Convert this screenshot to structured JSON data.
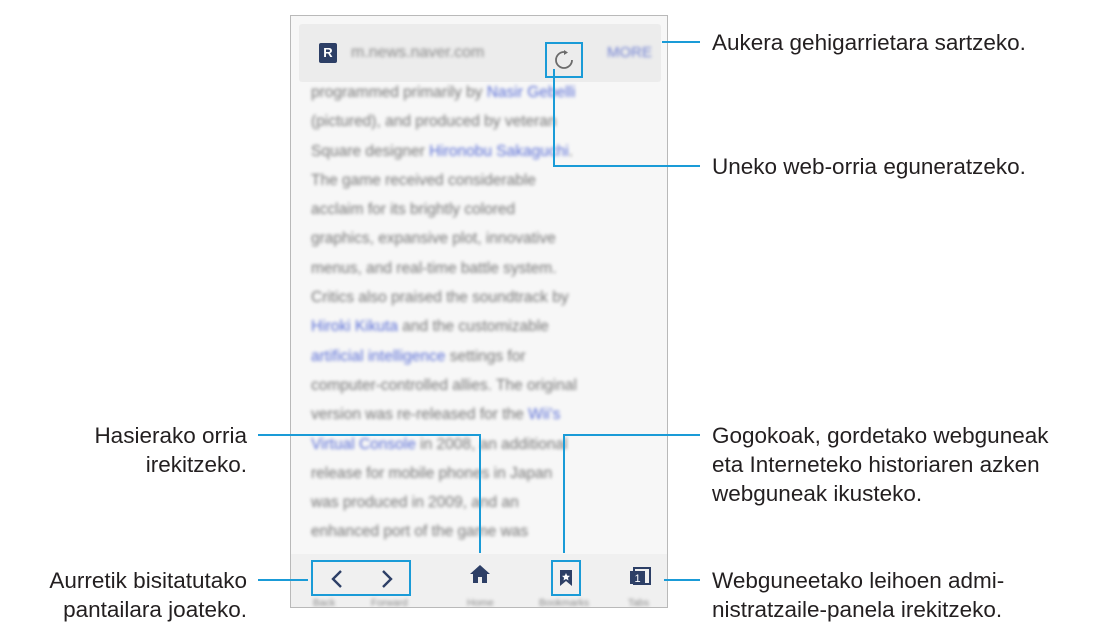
{
  "browser": {
    "url": "m.news.naver.com",
    "more_label": "MORE",
    "article_lines": [
      [
        {
          "t": "programmed primarily by "
        },
        {
          "t": "Nasir Gebelli",
          "link": true
        }
      ],
      [
        {
          "t": "(pictured), and produced by veteran"
        }
      ],
      [
        {
          "t": "Square designer "
        },
        {
          "t": "Hironobu Sakaguchi",
          "link": true
        },
        {
          "t": "."
        }
      ],
      [
        {
          "t": "The game received considerable"
        }
      ],
      [
        {
          "t": "acclaim for its brightly colored"
        }
      ],
      [
        {
          "t": "graphics, expansive plot, innovative"
        }
      ],
      [
        {
          "t": "menus, and real-time battle system."
        }
      ],
      [
        {
          "t": "Critics also praised the soundtrack by"
        }
      ],
      [
        {
          "t": "Hiroki Kikuta",
          "link": true
        },
        {
          "t": " and the customizable"
        }
      ],
      [
        {
          "t": "artificial intelligence",
          "link": true
        },
        {
          "t": " settings for"
        }
      ],
      [
        {
          "t": "computer-controlled allies. The original"
        }
      ],
      [
        {
          "t": "version was re-released for the "
        },
        {
          "t": "Wii's",
          "link": true
        }
      ],
      [
        {
          "t": "Virtual Console",
          "link": true
        },
        {
          "t": " in 2008, an additional"
        }
      ],
      [
        {
          "t": "release for mobile phones in Japan"
        }
      ],
      [
        {
          "t": "was produced in 2009, and an"
        }
      ],
      [
        {
          "t": "enhanced port of the game was"
        }
      ]
    ],
    "nav_labels": {
      "back": "Back",
      "forward": "Forward",
      "home": "Home",
      "bookmarks": "Bookmarks",
      "tabs": "Tabs"
    },
    "tabs_count": "1"
  },
  "callouts": {
    "more": "Aukera gehigarrietara sartzeko.",
    "refresh": "Uneko web-orria eguneratzeko.",
    "home_1": "Hasierako orria",
    "home_2": "irekitzeko.",
    "bookmarks_1": "Gogokoak, gordetako webguneak",
    "bookmarks_2": "eta Interneteko historiaren azken",
    "bookmarks_3": "webguneak ikusteko.",
    "nav_1": "Aurretik bisitatutako",
    "nav_2": "pantailara joateko.",
    "tabs_1": "Webguneetako leihoen admi-",
    "tabs_2": "nistratzaile-panela irekitzeko."
  },
  "colors": {
    "highlight": "#1a9bd7",
    "link": "#5b6fd6",
    "text": "#231f20",
    "icon": "#2d3f66"
  },
  "icons": [
    "refresh-icon",
    "chevron-left-icon",
    "chevron-right-icon",
    "home-icon",
    "bookmark-icon",
    "tabs-icon"
  ]
}
